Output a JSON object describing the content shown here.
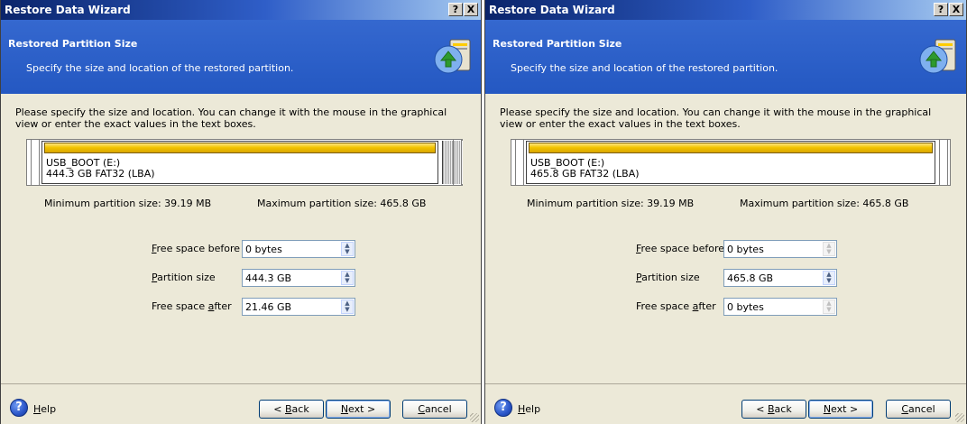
{
  "windows": [
    {
      "title": "Restore Data Wizard",
      "help_btn": "?",
      "close_btn": "X",
      "header_title": "Restored Partition Size",
      "header_subtitle": "Specify the size and location of the restored partition.",
      "description": "Please specify the size and location. You can change it with the mouse in the graphical view or enter the exact values in the text boxes.",
      "partition": {
        "name": "USB_BOOT (E:)",
        "info": "444.3 GB  FAT32 (LBA)"
      },
      "min_size": "Minimum partition size:  39.19 MB",
      "max_size": "Maximum partition size:  465.8 GB",
      "fields": [
        {
          "label_pre": "",
          "label_u": "F",
          "label_post": "ree space before",
          "value": "0 bytes"
        },
        {
          "label_pre": "",
          "label_u": "P",
          "label_post": "artition size",
          "value": "444.3 GB"
        },
        {
          "label_pre": "Free space ",
          "label_u": "a",
          "label_post": "fter",
          "value": "21.46 GB"
        }
      ],
      "help_label_u": "H",
      "help_label_rest": "elp",
      "back_lt": "< ",
      "back_u": "B",
      "back_rest": "ack",
      "next_u": "N",
      "next_rest": "ext >",
      "cancel_u": "C",
      "cancel_rest": "ancel"
    },
    {
      "title": "Restore Data Wizard",
      "help_btn": "?",
      "close_btn": "X",
      "header_title": "Restored Partition Size",
      "header_subtitle": "Specify the size and location of the restored partition.",
      "description": "Please specify the size and location. You can change it with the mouse in the graphical view or enter the exact values in the text boxes.",
      "partition": {
        "name": "USB_BOOT (E:)",
        "info": "465.8 GB  FAT32 (LBA)"
      },
      "min_size": "Minimum partition size:  39.19 MB",
      "max_size": "Maximum partition size:  465.8 GB",
      "fields": [
        {
          "label_pre": "",
          "label_u": "F",
          "label_post": "ree space before",
          "value": "0 bytes"
        },
        {
          "label_pre": "",
          "label_u": "P",
          "label_post": "artition size",
          "value": "465.8 GB"
        },
        {
          "label_pre": "Free space ",
          "label_u": "a",
          "label_post": "fter",
          "value": "0 bytes"
        }
      ],
      "help_label_u": "H",
      "help_label_rest": "elp",
      "back_lt": "< ",
      "back_u": "B",
      "back_rest": "ack",
      "next_u": "N",
      "next_rest": "ext >",
      "cancel_u": "C",
      "cancel_rest": "ancel"
    }
  ]
}
